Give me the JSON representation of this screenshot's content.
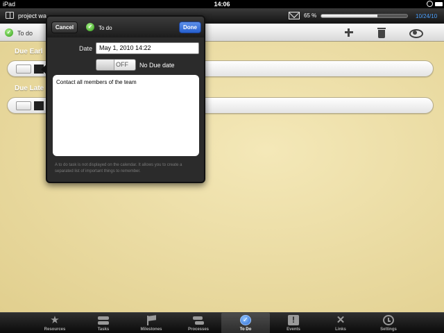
{
  "status_bar": {
    "carrier": "iPad",
    "time": "14:06"
  },
  "app_bar": {
    "project_title": "project wa",
    "battery_percent": "65 %",
    "progress_fraction": 0.65,
    "date": "10/24/10"
  },
  "toolbar": {
    "title": "To do"
  },
  "sections": [
    {
      "label": "Due Earl"
    },
    {
      "label": "Due Late"
    }
  ],
  "popover": {
    "cancel_label": "Cancel",
    "title": "To do",
    "done_label": "Done",
    "date_label": "Date",
    "date_value": "May 1, 2010 14:22",
    "toggle_label": "OFF",
    "no_due_label": "No Due date",
    "note_text": "Contact all members of the team",
    "help_text": "A to do task is not displayed on the calendar. It allows you to create a separated list of important things to remember."
  },
  "tabs": [
    {
      "label": "Resources",
      "icon": "star-icon"
    },
    {
      "label": "Tasks",
      "icon": "tasks-icon"
    },
    {
      "label": "Milestones",
      "icon": "flag-icon"
    },
    {
      "label": "Processes",
      "icon": "processes-icon"
    },
    {
      "label": "To Do",
      "icon": "todo-icon",
      "selected": true
    },
    {
      "label": "Events",
      "icon": "events-icon"
    },
    {
      "label": "Links",
      "icon": "links-icon"
    },
    {
      "label": "Settings",
      "icon": "clock-icon"
    }
  ],
  "colors": {
    "accent_blue": "#2660d0",
    "check_green": "#2e9c13",
    "paper": "#e9dba0"
  }
}
